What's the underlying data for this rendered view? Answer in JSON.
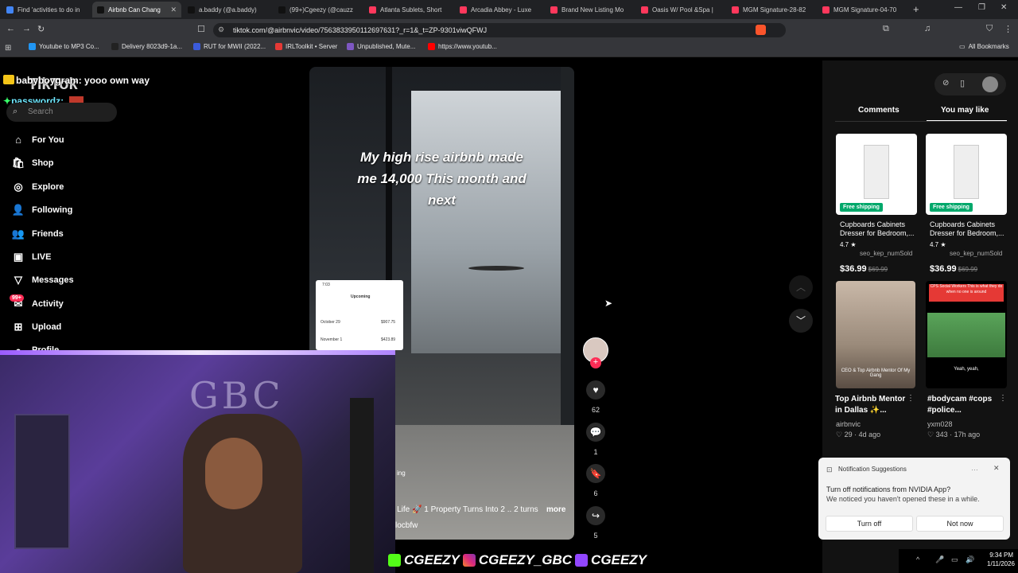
{
  "tabs": [
    {
      "label": "Find 'activities to do in",
      "fav": "#4285f4",
      "active": false
    },
    {
      "label": "Airbnb Can Chang",
      "fav": "#111111",
      "active": true
    },
    {
      "label": "a.baddy (@a.baddy)",
      "fav": "#111111",
      "active": false
    },
    {
      "label": "(99+)Cgeezy (@cauzz",
      "fav": "#111111",
      "active": false
    },
    {
      "label": "Atlanta Sublets, Short",
      "fav": "#ff385c",
      "active": false
    },
    {
      "label": "Arcadia Abbey - Luxe",
      "fav": "#ff385c",
      "active": false
    },
    {
      "label": "Brand New Listing Mo",
      "fav": "#ff385c",
      "active": false
    },
    {
      "label": "Oasis W/ Pool &Spa |",
      "fav": "#ff385c",
      "active": false
    },
    {
      "label": "MGM Signature-28-82",
      "fav": "#ff385c",
      "active": false
    },
    {
      "label": "MGM Signature-04-70",
      "fav": "#ff385c",
      "active": false
    }
  ],
  "url": "tiktok.com/@airbnvic/video/7563833950112697631?_r=1&_t=ZP-9301viwQFWJ",
  "bookmarks": [
    {
      "label": "Youtube to MP3 Co...",
      "color": "#2196f3"
    },
    {
      "label": "Delivery 8023d9-1a...",
      "color": "#222222"
    },
    {
      "label": "RUT for MWII (2022...",
      "color": "#3b5bdb"
    },
    {
      "label": "IRLToolkit • Server",
      "color": "#e53935"
    },
    {
      "label": "Unpublished, Mute...",
      "color": "#7e57c2"
    },
    {
      "label": "https://www.youtub...",
      "color": "#ff0000"
    }
  ],
  "all_bookmarks": "All Bookmarks",
  "chat": [
    {
      "user": "babyboygram",
      "msg": ": yooo own way",
      "color": "#fff"
    },
    {
      "user": "passwordz",
      "msg": ":",
      "color": "#6ee7ff"
    }
  ],
  "logo": "TikTok",
  "search_placeholder": "Search",
  "nav": [
    {
      "label": "For You",
      "icon": "⌂"
    },
    {
      "label": "Shop",
      "icon": "🛍"
    },
    {
      "label": "Explore",
      "icon": "◎"
    },
    {
      "label": "Following",
      "icon": "👤"
    },
    {
      "label": "Friends",
      "icon": "👥"
    },
    {
      "label": "LIVE",
      "icon": "▣"
    },
    {
      "label": "Messages",
      "icon": "▽"
    },
    {
      "label": "Activity",
      "icon": "✉"
    },
    {
      "label": "Upload",
      "icon": "⊞"
    },
    {
      "label": "Profile",
      "icon": "●"
    }
  ],
  "activity_badge": "99+",
  "video": {
    "caption": [
      "My high rise airbnb made",
      "me 14,000 This month and",
      "next"
    ],
    "desc": "r Life 🚀 1 Property Turns Into 2 .. 2 turns",
    "more": "more",
    "handle": "locbfw",
    "inset_label": "Upcoming",
    "inset_rows": [
      [
        "October 29",
        "$907.75"
      ],
      [
        "November 1",
        "$423.89"
      ]
    ],
    "ing": "ing"
  },
  "actions": [
    {
      "icon": "♥",
      "count": "62"
    },
    {
      "icon": "💬",
      "count": "1"
    },
    {
      "icon": "🔖",
      "count": "6"
    },
    {
      "icon": "↪",
      "count": "5"
    }
  ],
  "panel": {
    "tabs": [
      "Comments",
      "You may like"
    ],
    "products": [
      {
        "title": "Cupboards Cabinets Dresser for Bedroom,...",
        "rating": "4.7 ★",
        "sold": "seo_kep_numSold",
        "price": "$36.99",
        "old": "$69.99",
        "ship": "Free shipping"
      },
      {
        "title": "Cupboards Cabinets Dresser for Bedroom,...",
        "rating": "4.7 ★",
        "sold": "seo_kep_numSold",
        "price": "$36.99",
        "old": "$69.99",
        "ship": "Free shipping"
      }
    ],
    "videos": [
      {
        "title": "Top Airbnb Mentor in Dallas ✨...",
        "author": "airbnvic",
        "likes": "♡ 29",
        "age": "· 4d ago",
        "overlay": "CEO & Top Airbnb Mentor Of My Gang"
      },
      {
        "title": "#bodycam #cops #police...",
        "author": "yxm028",
        "likes": "♡ 343",
        "age": "· 17h ago",
        "overlay": "Yeah, yeah,",
        "top": "CPS Social Workers This is what they do when no one is around"
      }
    ]
  },
  "notification": {
    "app": "Notification Suggestions",
    "title": "Turn off notifications from NVIDIA App?",
    "body": "We noticed you haven't opened these in a while.",
    "btn1": "Turn off",
    "btn2": "Not now"
  },
  "stream_handles": [
    "CGEEZY",
    "CGEEZY_GBC",
    "CGEEZY"
  ],
  "cam_sign": "GBC",
  "clock": {
    "time": "9:34 PM",
    "date": "1/11/2026"
  }
}
